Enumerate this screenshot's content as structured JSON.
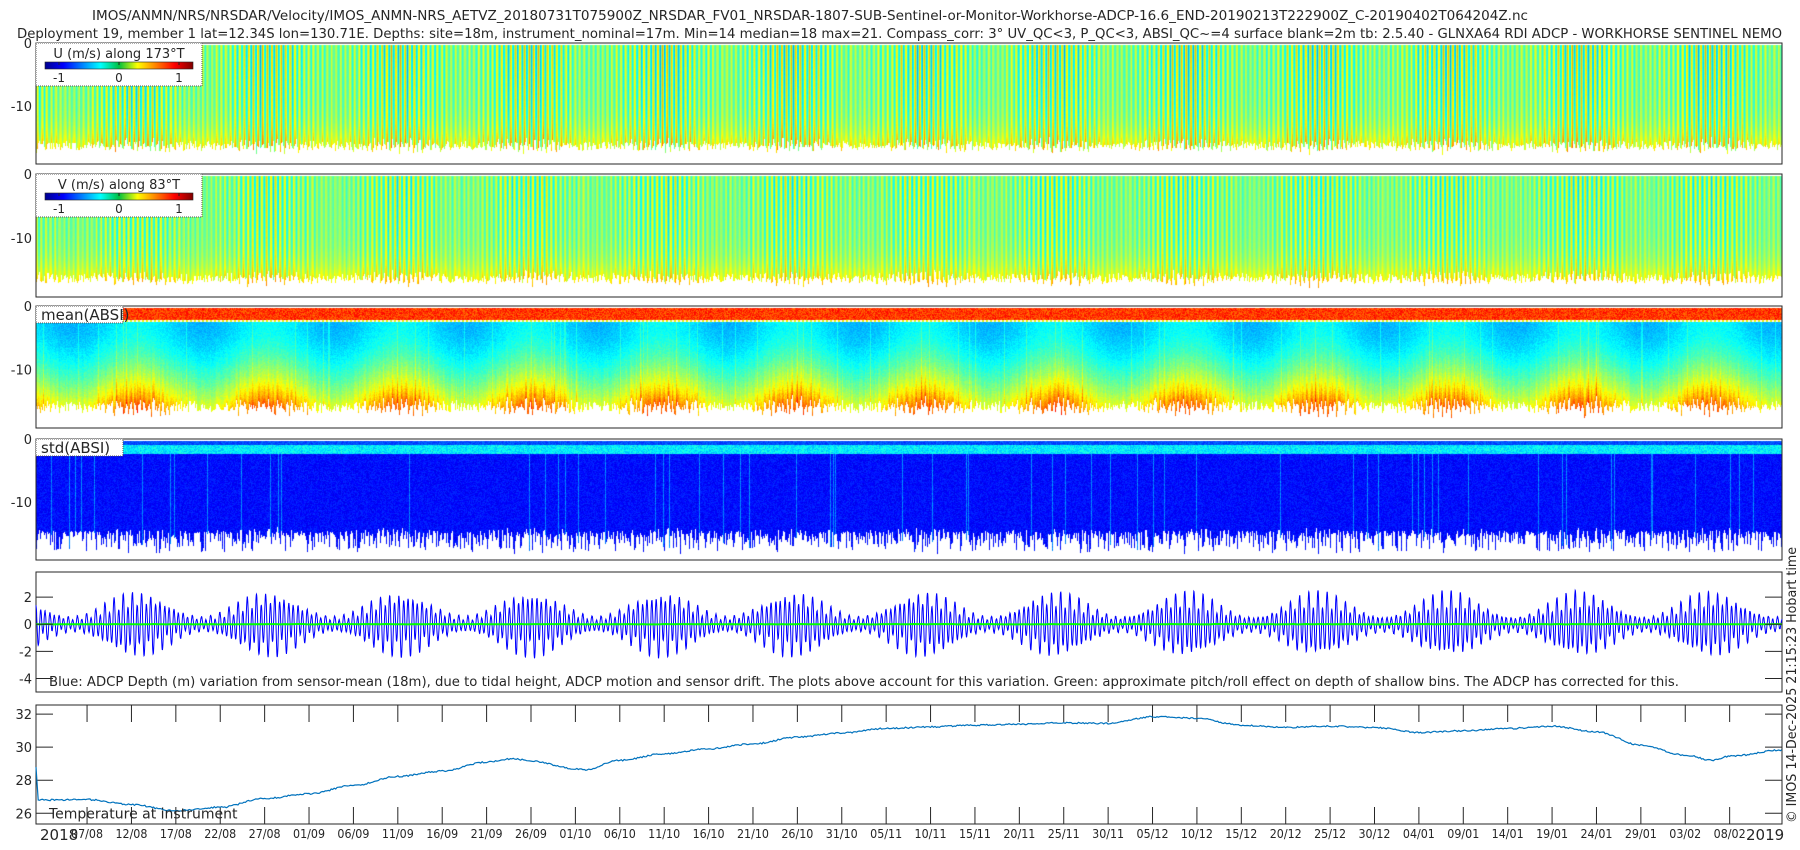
{
  "title": {
    "line1": "IMOS/ANMN/NRS/NRSDAR/Velocity/IMOS_ANMN-NRS_AETVZ_20180731T075900Z_NRSDAR_FV01_NRSDAR-1807-SUB-Sentinel-or-Monitor-Workhorse-ADCP-16.6_END-20190213T222900Z_C-20190402T064204Z.nc",
    "line2": "Deployment 19, member 1 lat=12.34S lon=130.71E. Depths: site=18m, instrument_nominal=17m. Min=14 median=18 max=21. Compass_corr: 3° UV_QC<3, P_QC<3, ABSI_QC~=4 surface blank=2m tb: 2.5.40 - GLNXA64 RDI ADCP - WORKHORSE SENTINEL NEMO"
  },
  "credit": "© IMOS 14-Dec-2025 21:15:23 Hobart time",
  "xaxis": {
    "xlim": [
      "2018-08-01T06:00",
      "2019-02-13T21:30"
    ],
    "tick_labels": [
      "07/08",
      "12/08",
      "17/08",
      "22/08",
      "27/08",
      "01/09",
      "06/09",
      "11/09",
      "16/09",
      "21/09",
      "26/09",
      "01/10",
      "06/10",
      "11/10",
      "16/10",
      "21/10",
      "26/10",
      "31/10",
      "05/11",
      "10/11",
      "15/11",
      "20/11",
      "25/11",
      "30/11",
      "05/12",
      "10/12",
      "15/12",
      "20/12",
      "25/12",
      "30/12",
      "04/01",
      "09/01",
      "14/01",
      "19/01",
      "24/01",
      "29/01",
      "03/02",
      "08/02"
    ],
    "year_labels": [
      "2018",
      "2019"
    ]
  },
  "colors": {
    "axes": "#000000",
    "depth_line": "#0000ff",
    "pitch_roll_line": "#00ff00",
    "temperature_line": "#0072bd"
  },
  "chart_data": [
    {
      "type": "heatmap",
      "label": "U (m/s) along 173°T",
      "colormap": "jet",
      "clim": [
        -1.23,
        1.23
      ],
      "colorbar_ticks": [
        "-1",
        "0",
        "1"
      ],
      "ylim": [
        -19.2,
        0
      ],
      "yticks": [
        0,
        -10
      ],
      "ytick_labels": [
        "0",
        "-10"
      ]
    },
    {
      "type": "heatmap",
      "label": "V (m/s) along 83°T",
      "colormap": "jet",
      "clim": [
        -1.23,
        1.23
      ],
      "colorbar_ticks": [
        "-1",
        "0",
        "1"
      ],
      "ylim": [
        -19.2,
        0
      ],
      "yticks": [
        0,
        -10
      ],
      "ytick_labels": [
        "0",
        "-10"
      ]
    },
    {
      "type": "heatmap",
      "label": "mean(ABSI)",
      "colormap": "jet",
      "ylim": [
        -19.2,
        0
      ],
      "yticks": [
        0,
        -10
      ],
      "ytick_labels": [
        "0",
        "-10"
      ]
    },
    {
      "type": "heatmap",
      "label": "std(ABSI)",
      "colormap": "jet",
      "ylim": [
        -19.2,
        0
      ],
      "yticks": [
        0,
        -10
      ],
      "ytick_labels": [
        "0",
        "-10"
      ]
    },
    {
      "type": "line",
      "ylim": [
        -5,
        3.85
      ],
      "yticks": [
        2,
        0,
        -2,
        -4
      ],
      "ytick_labels": [
        "2",
        "0",
        "-2",
        "-4"
      ],
      "depth_variation_amplitude_range_m": [
        0.8,
        3.4
      ],
      "pitch_roll_effect_m": 0,
      "annotation": "Blue: ADCP Depth (m) variation from sensor-mean (18m), due to tidal height, ADCP motion and sensor drift. The plots above account for this variation. Green: approximate pitch/roll effect on depth of shallow bins. The ADCP has corrected for this."
    },
    {
      "type": "line",
      "label": "Temperature at instrument",
      "ylim": [
        25.35,
        32.55
      ],
      "yticks": [
        26,
        28,
        30,
        32
      ],
      "ytick_labels": [
        "26",
        "28",
        "30",
        "32"
      ],
      "x": [
        "2018-08-01T06:00",
        "2018-08-01T12:00",
        "2018-08-07",
        "2018-08-12",
        "2018-08-17",
        "2018-08-22",
        "2018-08-27",
        "2018-09-01",
        "2018-09-06",
        "2018-09-11",
        "2018-09-16",
        "2018-09-21",
        "2018-09-24",
        "2018-09-26",
        "2018-10-01",
        "2018-10-02",
        "2018-10-06",
        "2018-10-11",
        "2018-10-16",
        "2018-10-21",
        "2018-10-26",
        "2018-10-31",
        "2018-11-05",
        "2018-11-10",
        "2018-11-15",
        "2018-11-20",
        "2018-11-25",
        "2018-11-30",
        "2018-12-05",
        "2018-12-10",
        "2018-12-15",
        "2018-12-20",
        "2018-12-25",
        "2018-12-30",
        "2019-01-04",
        "2019-01-09",
        "2019-01-14",
        "2019-01-19",
        "2019-01-24",
        "2019-01-29",
        "2019-02-03",
        "2019-02-06",
        "2019-02-08",
        "2019-02-13T21:00"
      ],
      "y": [
        28.8,
        26.8,
        26.83,
        26.52,
        26.16,
        26.36,
        26.9,
        27.17,
        27.68,
        28.23,
        28.55,
        29.1,
        29.3,
        29.16,
        28.7,
        28.63,
        29.2,
        29.6,
        29.9,
        30.2,
        30.6,
        30.86,
        31.13,
        31.23,
        31.33,
        31.39,
        31.47,
        31.43,
        31.84,
        31.74,
        31.33,
        31.19,
        31.27,
        31.19,
        30.89,
        30.99,
        31.13,
        31.27,
        30.93,
        30.12,
        29.52,
        29.21,
        29.45,
        29.82
      ]
    }
  ]
}
